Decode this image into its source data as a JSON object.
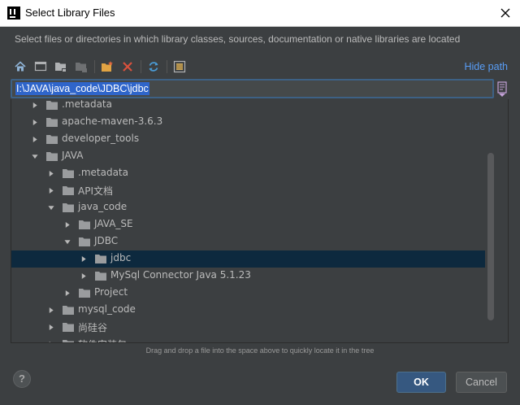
{
  "window": {
    "title": "Select Library Files"
  },
  "description": "Select files or directories in which library classes, sources, documentation or native libraries are located",
  "toolbar": {
    "icons": [
      "home-icon",
      "desktop-icon",
      "project-folder-icon",
      "module-folder-icon",
      "new-folder-icon",
      "delete-icon",
      "refresh-icon",
      "show-hidden-icon"
    ],
    "hide_path_label": "Hide path"
  },
  "path": {
    "value": "I:\\JAVA\\java_code\\JDBC\\jdbc"
  },
  "tree": {
    "items": [
      {
        "label": ".metadata",
        "depth": 0,
        "expanded": false
      },
      {
        "label": "apache-maven-3.6.3",
        "depth": 0,
        "expanded": false
      },
      {
        "label": "developer_tools",
        "depth": 0,
        "expanded": false
      },
      {
        "label": "JAVA",
        "depth": 0,
        "expanded": true
      },
      {
        "label": ".metadata",
        "depth": 1,
        "expanded": false
      },
      {
        "label": "API文档",
        "depth": 1,
        "expanded": false
      },
      {
        "label": "java_code",
        "depth": 1,
        "expanded": true
      },
      {
        "label": "JAVA_SE",
        "depth": 2,
        "expanded": false
      },
      {
        "label": "JDBC",
        "depth": 2,
        "expanded": true
      },
      {
        "label": "jdbc",
        "depth": 3,
        "expanded": false,
        "selected": true
      },
      {
        "label": "MySql Connector Java 5.1.23",
        "depth": 3,
        "expanded": false
      },
      {
        "label": "Project",
        "depth": 2,
        "expanded": false
      },
      {
        "label": "mysql_code",
        "depth": 1,
        "expanded": false
      },
      {
        "label": "尚硅谷",
        "depth": 1,
        "expanded": false
      },
      {
        "label": "软件安装包",
        "depth": 1,
        "expanded": false
      }
    ]
  },
  "hint": "Drag and drop a file into the space above to quickly locate it in the tree",
  "buttons": {
    "help": "?",
    "ok": "OK",
    "cancel": "Cancel"
  },
  "colors": {
    "background": "#3c3f41",
    "accent_link": "#589df6",
    "selection": "#0d293e",
    "path_selection": "#2f65ca",
    "ok_button": "#365880"
  }
}
